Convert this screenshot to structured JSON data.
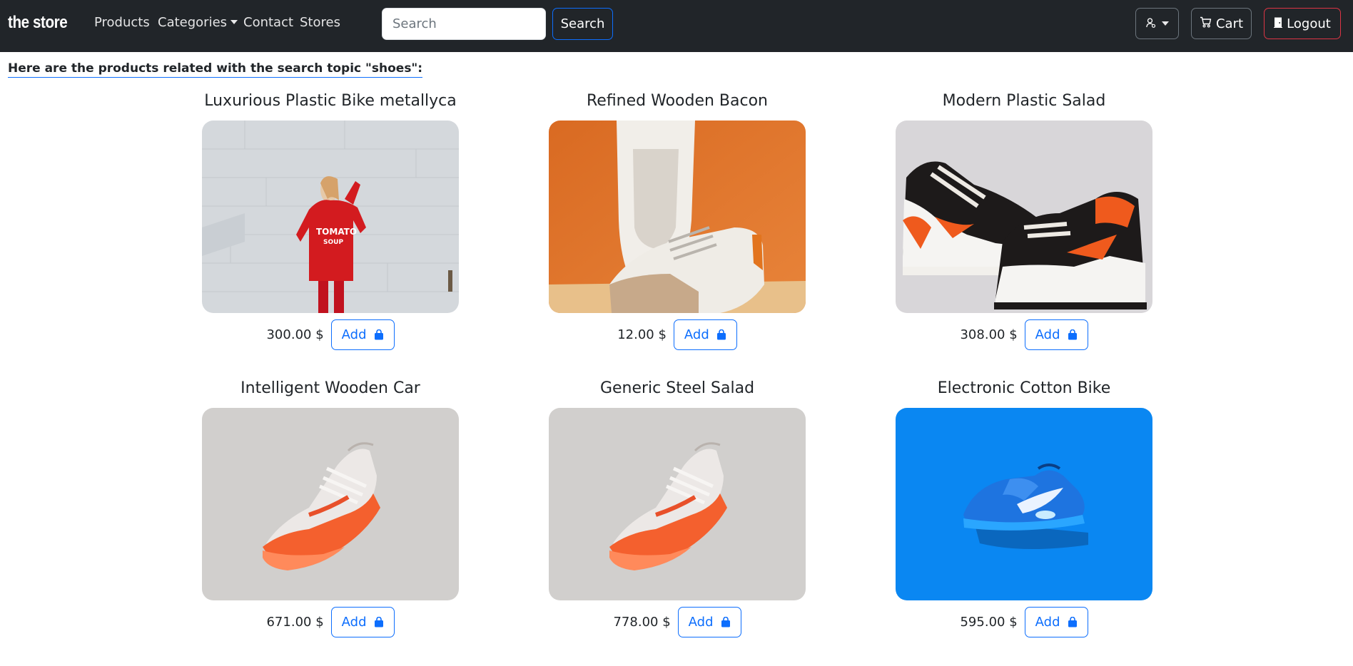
{
  "navbar": {
    "brand": "the store",
    "links": [
      "Products",
      "Categories",
      "Contact",
      "Stores"
    ],
    "search_placeholder": "Search",
    "search_button": "Search",
    "user_icon": "user-dropdown-icon",
    "cart_label": "Cart",
    "cart_icon": "cart-icon",
    "logout_label": "Logout",
    "logout_icon": "door-icon",
    "colors": {
      "background": "#212529",
      "primary": "#0d6efd",
      "danger": "#dc3545",
      "secondary": "#6c757d"
    }
  },
  "heading": "Here are the products related with the search topic \"shoes\":",
  "products": [
    {
      "name": "Luxurious Plastic Bike metallyca",
      "price": "300.00 $",
      "add_label": "Add",
      "image": "woman-red-sweater"
    },
    {
      "name": "Refined Wooden Bacon",
      "price": "12.00 $",
      "add_label": "Add",
      "image": "white-sneakers-orange-background"
    },
    {
      "name": "Modern Plastic Salad",
      "price": "308.00 $",
      "add_label": "Add",
      "image": "orange-black-high-top-sneakers"
    },
    {
      "name": "Intelligent Wooden Car",
      "price": "671.00 $",
      "add_label": "Add",
      "image": "orange-running-shoe"
    },
    {
      "name": "Generic Steel Salad",
      "price": "778.00 $",
      "add_label": "Add",
      "image": "orange-running-shoe"
    },
    {
      "name": "Electronic Cotton Bike",
      "price": "595.00 $",
      "add_label": "Add",
      "image": "blue-sneaker-blue-background"
    }
  ]
}
